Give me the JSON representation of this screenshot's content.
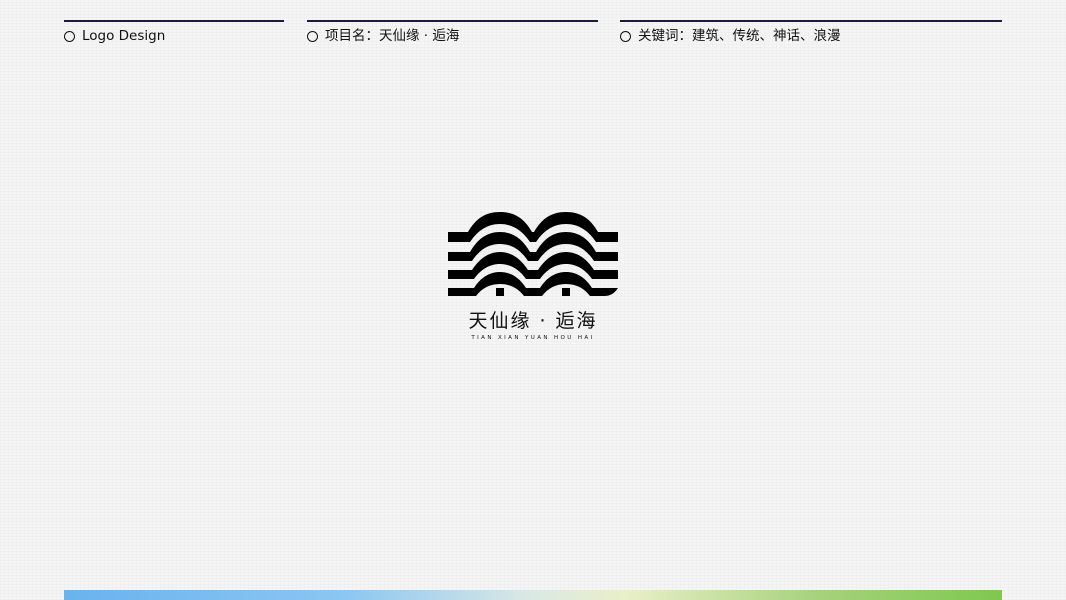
{
  "header": {
    "items": [
      {
        "label": "Logo Design"
      },
      {
        "label": "项目名：天仙缘 · 逅海"
      },
      {
        "label": "关键词：建筑、传统、神话、浪漫"
      }
    ]
  },
  "logo": {
    "title": "天仙缘 · 逅海",
    "subtitle": "TIAN XIAN YUAN HOU HAI",
    "icon": "wave-roof-logo-icon",
    "color": "#000000"
  },
  "colors": {
    "header_rule": "#1a1e3a",
    "gradient_start": "#69b3ee",
    "gradient_end": "#7ec84f"
  }
}
